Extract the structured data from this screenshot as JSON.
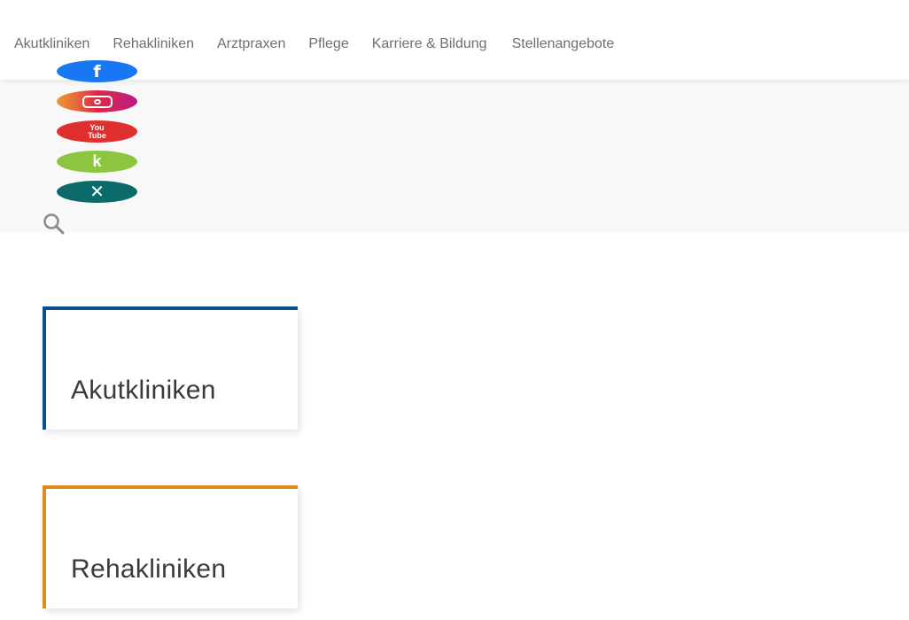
{
  "nav": {
    "items": [
      {
        "label": "Akutkliniken"
      },
      {
        "label": "Rehakliniken"
      },
      {
        "label": "Arztpraxen"
      },
      {
        "label": "Pflege"
      },
      {
        "label": "Karriere & Bildung"
      },
      {
        "label": "Stellenangebote"
      }
    ]
  },
  "social": {
    "facebook": {
      "icon": "facebook-icon",
      "glyph": "f",
      "color": "#1877f2"
    },
    "instagram": {
      "icon": "instagram-icon",
      "color": "#dc2743"
    },
    "youtube": {
      "icon": "youtube-icon",
      "line1": "You",
      "line2": "Tube",
      "color": "#e02f2f"
    },
    "kununu": {
      "icon": "kununu-icon",
      "glyph": "k",
      "color": "#8cc63f"
    },
    "xing": {
      "icon": "xing-icon",
      "glyph": "✕",
      "color": "#0b6a6a"
    }
  },
  "search": {
    "icon": "search-icon"
  },
  "cards": [
    {
      "title": "Akutkliniken",
      "accent": "#0b4e8a"
    },
    {
      "title": "Rehakliniken",
      "accent": "#e08a1e"
    }
  ]
}
